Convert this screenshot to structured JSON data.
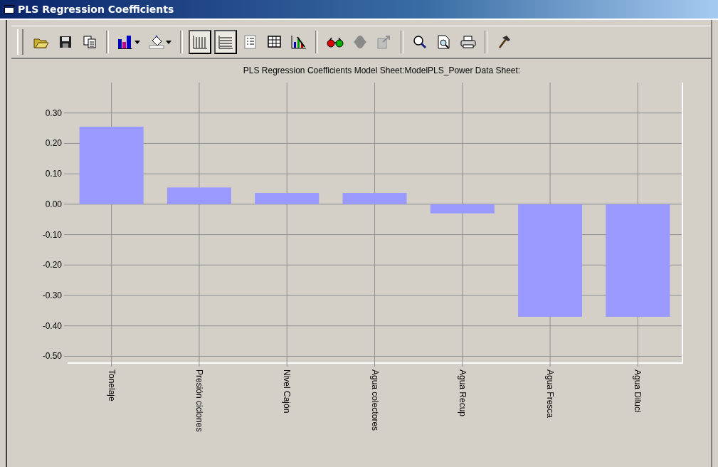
{
  "window": {
    "title": "PLS Regression Coefficients"
  },
  "toolbar": [
    [
      {
        "kind": "open",
        "pressed": false
      },
      {
        "kind": "save",
        "pressed": false
      },
      {
        "kind": "copy",
        "pressed": false
      }
    ],
    [
      {
        "kind": "bar-chart",
        "pressed": false,
        "dropdown": true
      },
      {
        "kind": "paint",
        "pressed": false,
        "dropdown": true
      }
    ],
    [
      {
        "kind": "vgrid",
        "pressed": true
      },
      {
        "kind": "hgrid",
        "pressed": true
      },
      {
        "kind": "legend",
        "pressed": false
      },
      {
        "kind": "table",
        "pressed": false
      },
      {
        "kind": "wizard",
        "pressed": false
      }
    ],
    [
      {
        "kind": "glasses",
        "pressed": false
      },
      {
        "kind": "blob",
        "pressed": false
      },
      {
        "kind": "export",
        "pressed": false
      }
    ],
    [
      {
        "kind": "zoom",
        "pressed": false
      },
      {
        "kind": "preview",
        "pressed": false
      },
      {
        "kind": "print",
        "pressed": false
      }
    ],
    [
      {
        "kind": "hammer",
        "pressed": false
      }
    ]
  ],
  "chart_data": {
    "type": "bar",
    "title": "PLS Regression Coefficients  Model Sheet:ModelPLS_Power Data Sheet:",
    "categories": [
      "Tonelaje",
      "Presión ciclones",
      "Nivel Cajón",
      "Agua colectores",
      "Agua Recup",
      "Agua Fresca",
      "Agua Diluci"
    ],
    "grid": true,
    "series": [
      {
        "color": "#9999ff",
        "values": [
          0.255,
          0.055,
          0.037,
          0.037,
          -0.03,
          -0.37,
          -0.37
        ]
      }
    ],
    "ylim": [
      -0.52,
      0.4
    ],
    "yticks": [
      {
        "value": 0.3,
        "label": "0.30"
      },
      {
        "value": 0.2,
        "label": "0.20"
      },
      {
        "value": 0.1,
        "label": "0.10"
      },
      {
        "value": 0,
        "label": "0.00"
      },
      {
        "value": -0.1,
        "label": "-0.10"
      },
      {
        "value": -0.2,
        "label": "-0.20"
      },
      {
        "value": -0.3,
        "label": "-0.30"
      },
      {
        "value": -0.4,
        "label": "-0.40"
      },
      {
        "value": -0.5,
        "label": "-0.50"
      }
    ]
  }
}
